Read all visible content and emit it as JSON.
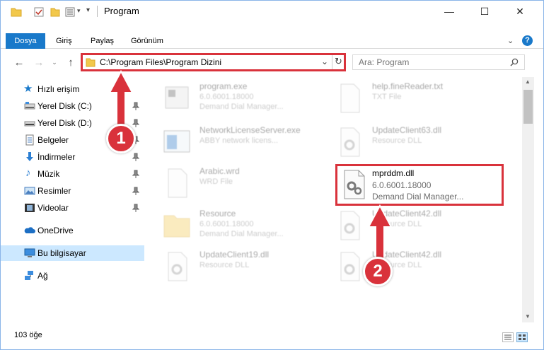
{
  "window": {
    "title": "Program",
    "controls": {
      "minimize": "—",
      "maximize": "☐",
      "close": "✕"
    }
  },
  "ribbon": {
    "tabs": [
      "Dosya",
      "Giriş",
      "Paylaş",
      "Görünüm"
    ],
    "help": "?"
  },
  "address": {
    "path": "C:\\Program Files\\Program Dizini",
    "search_placeholder": "Ara: Program"
  },
  "nav": {
    "quick_access": "Hızlı erişim",
    "items": [
      {
        "label": "Yerel Disk (C:)",
        "icon": "drive-icon"
      },
      {
        "label": "Yerel Disk (D:)",
        "icon": "drive-icon"
      },
      {
        "label": "Belgeler",
        "icon": "documents-icon"
      },
      {
        "label": "İndirmeler",
        "icon": "download-icon"
      },
      {
        "label": "Müzik",
        "icon": "music-icon"
      },
      {
        "label": "Resimler",
        "icon": "pictures-icon"
      },
      {
        "label": "Videolar",
        "icon": "videos-icon"
      }
    ],
    "onedrive": "OneDrive",
    "this_pc": "Bu bilgisayar",
    "network": "Ağ"
  },
  "files": [
    {
      "name": "program.exe",
      "line1": "6.0.6001.18000",
      "line2": "Demand Dial Manager..."
    },
    {
      "name": "help.fineReader.txt",
      "line1": "TXT File",
      "line2": ""
    },
    {
      "name": "NetworkLicenseServer.exe",
      "line1": "ABBY network licens...",
      "line2": ""
    },
    {
      "name": "UpdateClient63.dll",
      "line1": "Resource DLL",
      "line2": ""
    },
    {
      "name": "Arabic.wrd",
      "line1": "WRD File",
      "line2": ""
    },
    {
      "name": "Resource",
      "line1": "6.0.6001.18000",
      "line2": "Demand Dial Manager..."
    },
    {
      "name": "UpdateClient42.dll",
      "line1": "Resource DLL",
      "line2": ""
    },
    {
      "name": "UpdateClient19.dll",
      "line1": "Resource DLL",
      "line2": ""
    },
    {
      "name": "UpdateClient42.dll",
      "line1": "Resource DLL",
      "line2": ""
    }
  ],
  "focus_file": {
    "name": "mprddm.dll",
    "line1": "6.0.6001.18000",
    "line2": "Demand Dial Manager..."
  },
  "status": {
    "count": "103 öğe"
  },
  "callouts": [
    "1",
    "2"
  ],
  "colors": {
    "accent": "#1979ca",
    "highlight": "#d9323b",
    "selection": "#cce8ff"
  }
}
